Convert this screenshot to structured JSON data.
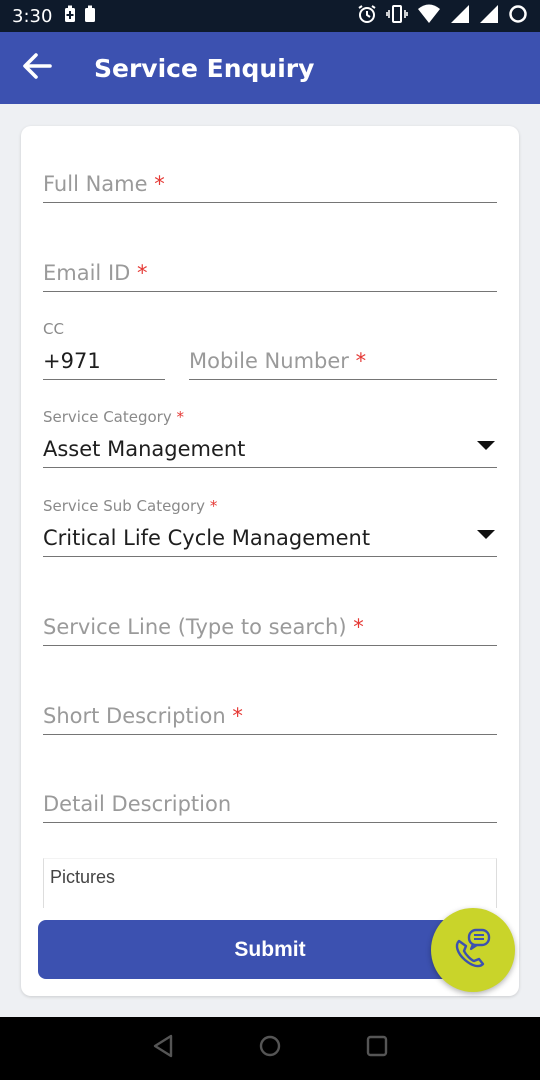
{
  "status_bar": {
    "time": "3:30",
    "icons": [
      "battery-saver-icon",
      "battery-icon",
      "alarm-icon",
      "vibrate-icon",
      "wifi-icon",
      "signal-icon",
      "signal-roaming-icon",
      "loading-circle-icon"
    ]
  },
  "app_bar": {
    "title": "Service Enquiry",
    "back_icon": "arrow-back-icon",
    "color": "#3c51b0"
  },
  "form": {
    "full_name": {
      "placeholder": "Full Name",
      "required_mark": "*"
    },
    "email": {
      "placeholder": "Email ID",
      "required_mark": "*"
    },
    "cc": {
      "label": "CC",
      "value": "+971"
    },
    "mobile": {
      "placeholder": "Mobile Number",
      "required_mark": "*"
    },
    "service_category": {
      "label": "Service Category",
      "required_mark": "*",
      "value": "Asset Management"
    },
    "service_sub_category": {
      "label": "Service Sub Category",
      "required_mark": "*",
      "value": "Critical Life Cycle Management"
    },
    "service_line": {
      "placeholder": "Service Line (Type to search)",
      "required_mark": "*"
    },
    "short_description": {
      "placeholder": "Short Description",
      "required_mark": "*"
    },
    "detail_description": {
      "placeholder": "Detail Description"
    },
    "pictures": {
      "label": "Pictures"
    },
    "submit_label": "Submit"
  },
  "fab": {
    "icon": "phone-chat-icon",
    "color": "#c9d42a"
  },
  "nav_bar": {
    "icons": [
      "back-triangle-icon",
      "home-circle-icon",
      "recents-square-icon"
    ]
  }
}
